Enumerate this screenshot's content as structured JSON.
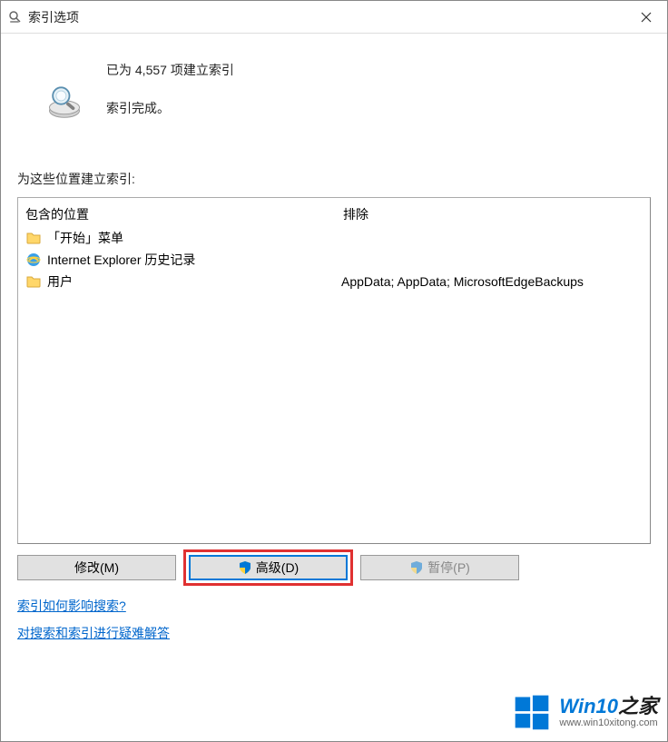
{
  "title": "索引选项",
  "status": {
    "count_line": "已为 4,557 项建立索引",
    "done_line": "索引完成。"
  },
  "section_label": "为这些位置建立索引:",
  "headers": {
    "included": "包含的位置",
    "excluded": "排除"
  },
  "locations": [
    {
      "icon": "folder",
      "name": "「开始」菜单",
      "exclude": ""
    },
    {
      "icon": "ie",
      "name": "Internet Explorer 历史记录",
      "exclude": ""
    },
    {
      "icon": "folder",
      "name": "用户",
      "exclude": "AppData; AppData; MicrosoftEdgeBackups"
    }
  ],
  "buttons": {
    "modify": "修改(M)",
    "advanced": "高级(D)",
    "pause": "暂停(P)"
  },
  "links": {
    "how": "索引如何影响搜索?",
    "troubleshoot": "对搜索和索引进行疑难解答"
  },
  "watermark": {
    "title_a": "Win10",
    "title_b": "之家",
    "sub": "www.win10xitong.com"
  }
}
